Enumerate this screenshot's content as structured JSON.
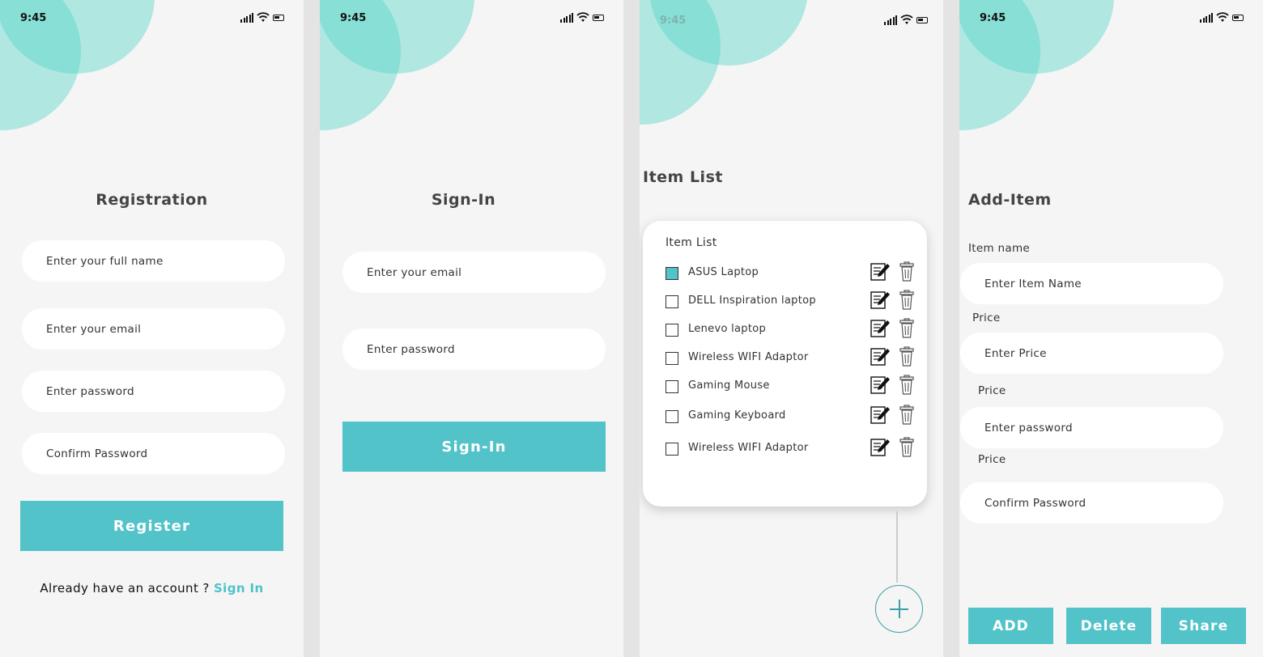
{
  "status": {
    "time": "9:45"
  },
  "registration": {
    "title": "Registration",
    "fields": [
      "Enter your full name",
      "Enter your email",
      "Enter password",
      "Confirm Password"
    ],
    "button": "Register",
    "footer_text": "Already have an account ? ",
    "footer_link": "Sign In"
  },
  "signin": {
    "title": "Sign-In",
    "fields": [
      "Enter your email",
      "Enter password"
    ],
    "button": "Sign-In"
  },
  "itemlist": {
    "title": "Item List",
    "card_title": "Item List",
    "items": [
      {
        "label": "ASUS Laptop",
        "checked": true
      },
      {
        "label": "DELL Inspiration laptop",
        "checked": false
      },
      {
        "label": "Lenevo laptop",
        "checked": false
      },
      {
        "label": "Wireless WIFI Adaptor",
        "checked": false
      },
      {
        "label": "Gaming Mouse",
        "checked": false
      },
      {
        "label": "Gaming Keyboard",
        "checked": false
      },
      {
        "label": "Wireless WIFI Adaptor",
        "checked": false
      }
    ]
  },
  "additem": {
    "title": "Add-Item",
    "labels": [
      "Item name",
      "Price",
      "Price",
      "Price"
    ],
    "fields": [
      "Enter Item Name",
      "Enter Price",
      "Enter password",
      "Confirm Password"
    ],
    "buttons": [
      "ADD",
      "Delete",
      "Share"
    ]
  },
  "colors": {
    "accent": "#51c3c9",
    "circle": "#50d3c6",
    "background": "#f5f5f5"
  },
  "icons": [
    "signal-icon",
    "wifi-icon",
    "battery-icon",
    "edit-icon",
    "trash-icon",
    "plus-icon"
  ]
}
